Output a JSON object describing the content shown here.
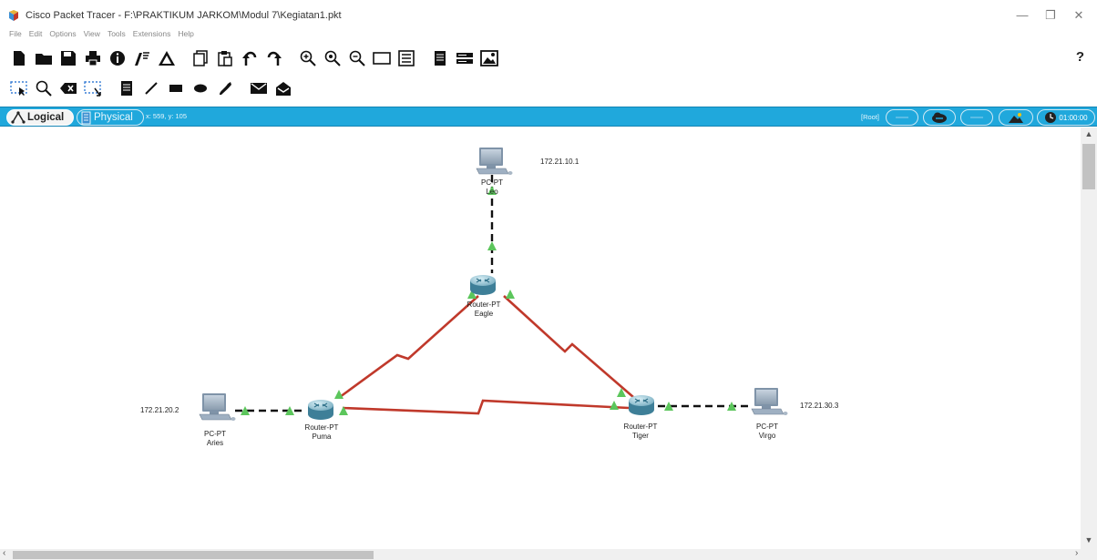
{
  "window": {
    "title": "Cisco Packet Tracer - F:\\PRAKTIKUM JARKOM\\Modul 7\\Kegiatan1.pkt",
    "minimize_glyph": "—",
    "maximize_glyph": "❐",
    "close_glyph": "✕"
  },
  "menu": [
    "File",
    "Edit",
    "Options",
    "View",
    "Tools",
    "Extensions",
    "Help"
  ],
  "toolbar": {
    "help_label": "?",
    "main_icons": [
      "new-icon",
      "open-icon",
      "save-icon",
      "print-icon",
      "info-icon",
      "activity-wizard-icon",
      "custom-device-icon",
      "copy-icon",
      "paste-icon",
      "undo-icon",
      "redo-icon",
      "zoom-in-icon",
      "zoom-reset-icon",
      "zoom-out-icon",
      "drawing-palette-icon",
      "custom-devices-dialog-icon",
      "notes-icon",
      "multiuser-icon",
      "screenshot-icon"
    ],
    "secondary_icons": [
      "select-icon",
      "inspect-icon",
      "delete-icon",
      "resize-icon",
      "place-note-icon",
      "draw-line-icon",
      "draw-rectangle-icon",
      "draw-ellipse-icon",
      "freeform-icon",
      "simple-pdu-icon",
      "complex-pdu-icon"
    ]
  },
  "workspace_bar": {
    "logical_label": "Logical",
    "physical_label": "Physical",
    "coords": "x: 559, y: 105",
    "root_label": "[Root]",
    "clock": "01:00:00",
    "colors": {
      "bar": "#20a8dc",
      "link": "#c0392b",
      "port": "#5cc65c"
    }
  },
  "devices": [
    {
      "id": "leo",
      "model": "PC-PT",
      "name": "Leo",
      "ip": "172.21.10.1"
    },
    {
      "id": "eagle",
      "model": "Router-PT",
      "name": "Eagle"
    },
    {
      "id": "aries",
      "model": "PC-PT",
      "name": "Aries",
      "ip": "172.21.20.2"
    },
    {
      "id": "puma",
      "model": "Router-PT",
      "name": "Puma"
    },
    {
      "id": "tiger",
      "model": "Router-PT",
      "name": "Tiger"
    },
    {
      "id": "virgo",
      "model": "PC-PT",
      "name": "Virgo",
      "ip": "172.21.30.3"
    }
  ],
  "links": [
    {
      "from": "leo",
      "to": "eagle",
      "type": "ethernet"
    },
    {
      "from": "aries",
      "to": "puma",
      "type": "ethernet"
    },
    {
      "from": "tiger",
      "to": "virgo",
      "type": "ethernet"
    },
    {
      "from": "eagle",
      "to": "puma",
      "type": "serial"
    },
    {
      "from": "eagle",
      "to": "tiger",
      "type": "serial"
    },
    {
      "from": "puma",
      "to": "tiger",
      "type": "serial"
    }
  ]
}
